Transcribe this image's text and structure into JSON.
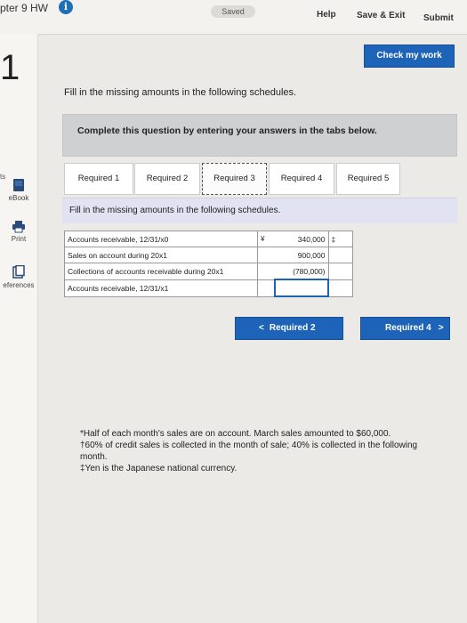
{
  "header": {
    "chapter": "pter 9 HW",
    "saved": "Saved",
    "help": "Help",
    "save_exit": "Save & Exit",
    "submit": "Submit",
    "check_work": "Check my work"
  },
  "question": {
    "number": "1",
    "instruction": "Fill in the missing amounts in the following schedules."
  },
  "leftnav": {
    "ts": "ts",
    "ebook": "eBook",
    "print": "Print",
    "references": "eferences"
  },
  "complete_box": "Complete this question by entering your answers in the tabs below.",
  "tabs": [
    {
      "label": "Required 1"
    },
    {
      "label": "Required 2"
    },
    {
      "label": "Required 3"
    },
    {
      "label": "Required 4"
    },
    {
      "label": "Required 5"
    }
  ],
  "active_tab_index": 2,
  "panel_instruction": "Fill in the missing amounts in the following schedules.",
  "schedule": {
    "rows": [
      {
        "label": "Accounts receivable, 12/31/x0",
        "currency": "¥",
        "value": "340,000",
        "mark": "‡"
      },
      {
        "label": "Sales on account during 20x1",
        "currency": "",
        "value": "900,000",
        "mark": ""
      },
      {
        "label": "Collections of accounts receivable during 20x1",
        "currency": "",
        "value": "(780,000)",
        "mark": ""
      },
      {
        "label": "Accounts receivable, 12/31/x1",
        "currency": "",
        "value": "",
        "mark": ""
      }
    ]
  },
  "nav": {
    "prev": "Required 2",
    "next": "Required 4"
  },
  "footnotes": [
    "*Half of each month's sales are on account. March sales amounted to $60,000.",
    "†60% of credit sales is collected in the month of sale; 40% is collected in the following month.",
    "‡Yen is the Japanese national currency."
  ],
  "colors": {
    "accent": "#1d63b7",
    "complete_box_bg": "#cfd0d1",
    "panel_bg": "#e2e3f2"
  }
}
